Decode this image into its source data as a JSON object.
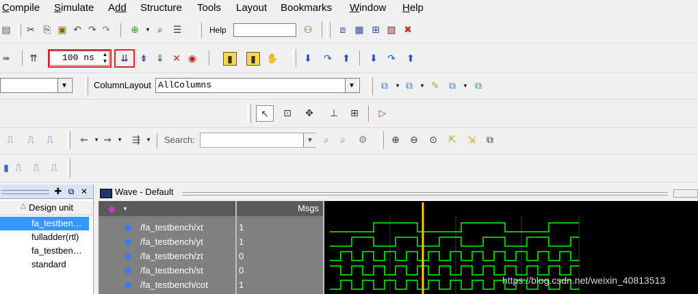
{
  "menu": {
    "items": [
      {
        "first": "C",
        "rest": "ompile"
      },
      {
        "first": "S",
        "rest": "imulate"
      },
      {
        "first": "A",
        "rest": "dd"
      },
      {
        "first": "S",
        "rest": "tructure"
      },
      {
        "first": "T",
        "rest": "ools"
      },
      {
        "first": "L",
        "rest": "ayout"
      },
      {
        "first": "B",
        "rest": "ookmarks"
      },
      {
        "first": "W",
        "rest": "indow"
      },
      {
        "first": "H",
        "rest": "elp"
      }
    ]
  },
  "toolbar": {
    "help_label": "Help",
    "help_value": "",
    "run_length_value": "100 ns",
    "column_layout_label": "ColumnLayout",
    "column_layout_value": "AllColumns",
    "search_label": "Search:",
    "search_value": ""
  },
  "structure_panel": {
    "column_header": "Design unit",
    "items": [
      "fa_testben…",
      "fulladder(rtl)",
      "fa_testben…",
      "standard"
    ],
    "selected_index": 0
  },
  "wave_panel": {
    "title": "Wave - Default",
    "msgs_header": "Msgs",
    "signals": [
      {
        "name": "/fa_testbench/xt",
        "value": "1"
      },
      {
        "name": "/fa_testbench/yt",
        "value": "1"
      },
      {
        "name": "/fa_testbench/zt",
        "value": "0"
      },
      {
        "name": "/fa_testbench/st",
        "value": "0"
      },
      {
        "name": "/fa_testbench/cot",
        "value": "1"
      }
    ],
    "wave_color": "#00ff00",
    "cursor_color": "#ffcc00",
    "background_color": "#000000"
  },
  "watermark": "https://blog.csdn.net/weixin_40813513"
}
